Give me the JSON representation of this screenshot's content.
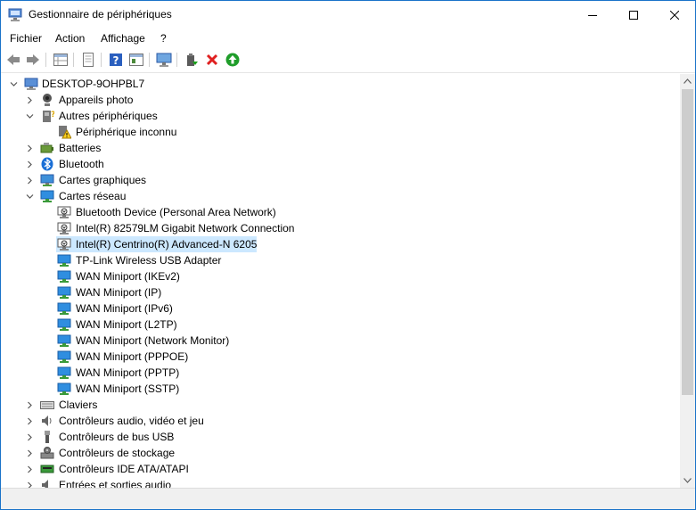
{
  "window": {
    "title": "Gestionnaire de périphériques"
  },
  "menu": [
    "Fichier",
    "Action",
    "Affichage",
    "?"
  ],
  "toolbar_icons": [
    "back-arrow-icon",
    "forward-arrow-icon",
    "properties-grid-icon",
    "document-icon",
    "help-icon",
    "view-icon",
    "monitor-icon",
    "update-driver-icon",
    "uninstall-x-icon",
    "enable-device-icon"
  ],
  "tree": {
    "root": "DESKTOP-9OHPBL7",
    "items": [
      {
        "label": "Appareils photo",
        "expanded": false,
        "icon": "camera-icon"
      },
      {
        "label": "Autres périphériques",
        "expanded": true,
        "icon": "unknown-device-icon",
        "children": [
          {
            "label": "Périphérique inconnu",
            "icon": "warning-device-icon"
          }
        ]
      },
      {
        "label": "Batteries",
        "expanded": false,
        "icon": "battery-icon"
      },
      {
        "label": "Bluetooth",
        "expanded": false,
        "icon": "bluetooth-icon"
      },
      {
        "label": "Cartes graphiques",
        "expanded": false,
        "icon": "display-adapter-icon"
      },
      {
        "label": "Cartes réseau",
        "expanded": true,
        "icon": "network-adapter-icon",
        "children": [
          {
            "label": "Bluetooth Device (Personal Area Network)",
            "icon": "network-disabled-icon"
          },
          {
            "label": "Intel(R) 82579LM Gigabit Network Connection",
            "icon": "network-disabled-icon"
          },
          {
            "label": "Intel(R) Centrino(R) Advanced-N 6205",
            "icon": "network-disabled-icon",
            "selected": true
          },
          {
            "label": "TP-Link Wireless USB Adapter",
            "icon": "network-adapter-icon"
          },
          {
            "label": "WAN Miniport (IKEv2)",
            "icon": "network-adapter-icon"
          },
          {
            "label": "WAN Miniport (IP)",
            "icon": "network-adapter-icon"
          },
          {
            "label": "WAN Miniport (IPv6)",
            "icon": "network-adapter-icon"
          },
          {
            "label": "WAN Miniport (L2TP)",
            "icon": "network-adapter-icon"
          },
          {
            "label": "WAN Miniport (Network Monitor)",
            "icon": "network-adapter-icon"
          },
          {
            "label": "WAN Miniport (PPPOE)",
            "icon": "network-adapter-icon"
          },
          {
            "label": "WAN Miniport (PPTP)",
            "icon": "network-adapter-icon"
          },
          {
            "label": "WAN Miniport (SSTP)",
            "icon": "network-adapter-icon"
          }
        ]
      },
      {
        "label": "Claviers",
        "expanded": false,
        "icon": "keyboard-icon"
      },
      {
        "label": "Contrôleurs audio, vidéo et jeu",
        "expanded": false,
        "icon": "audio-icon"
      },
      {
        "label": "Contrôleurs de bus USB",
        "expanded": false,
        "icon": "usb-icon"
      },
      {
        "label": "Contrôleurs de stockage",
        "expanded": false,
        "icon": "storage-icon"
      },
      {
        "label": "Contrôleurs IDE ATA/ATAPI",
        "expanded": false,
        "icon": "ide-icon"
      },
      {
        "label": "Entrées et sorties audio",
        "expanded": false,
        "icon": "audio-io-icon"
      }
    ]
  }
}
